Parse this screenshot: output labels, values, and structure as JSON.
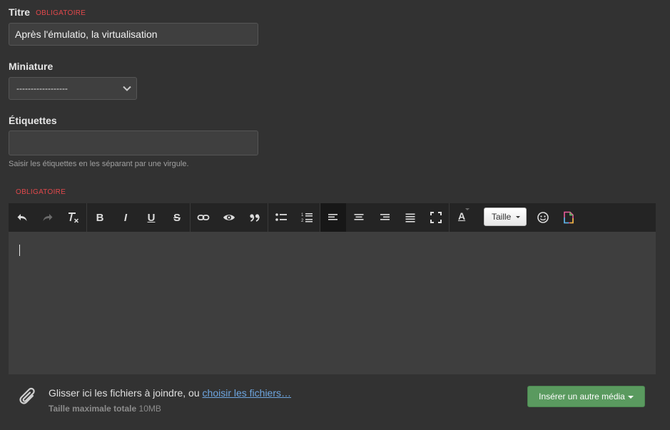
{
  "form": {
    "title": {
      "label": "Titre",
      "required": "OBLIGATOIRE",
      "value": "Après l'émulatio, la virtualisation"
    },
    "thumbnail": {
      "label": "Miniature",
      "selected": "------------------"
    },
    "tags": {
      "label": "Étiquettes",
      "value": "",
      "help": "Saisir les étiquettes en les séparant par une virgule."
    }
  },
  "editor": {
    "required": "OBLIGATOIRE",
    "toolbar": {
      "buttons": [
        {
          "name": "undo",
          "icon": "undo-icon"
        },
        {
          "name": "redo",
          "icon": "redo-icon"
        },
        {
          "name": "remove-format",
          "icon": "clear-format-icon"
        },
        {
          "name": "bold",
          "label": "B"
        },
        {
          "name": "italic",
          "label": "I"
        },
        {
          "name": "underline",
          "label": "U"
        },
        {
          "name": "strikethrough",
          "label": "S"
        },
        {
          "name": "link",
          "icon": "link-icon"
        },
        {
          "name": "preview",
          "icon": "eye-icon"
        },
        {
          "name": "quote",
          "icon": "quote-icon"
        },
        {
          "name": "bullet-list",
          "icon": "bullet-list-icon"
        },
        {
          "name": "numbered-list",
          "icon": "numbered-list-icon"
        },
        {
          "name": "align-left",
          "icon": "align-left-icon",
          "active": true
        },
        {
          "name": "align-center",
          "icon": "align-center-icon"
        },
        {
          "name": "align-right",
          "icon": "align-right-icon"
        },
        {
          "name": "justify",
          "icon": "justify-icon"
        },
        {
          "name": "fullscreen",
          "icon": "fullscreen-icon"
        },
        {
          "name": "text-color",
          "label": "A"
        },
        {
          "name": "emoji",
          "icon": "smiley-icon"
        },
        {
          "name": "paste-word",
          "icon": "document-icon"
        }
      ],
      "size_label": "Taille"
    },
    "content": ""
  },
  "attachments": {
    "drop_text": "Glisser ici les fichiers à joindre, ou ",
    "choose_link": "choisir les fichiers…",
    "max_size_label": "Taille maximale totale",
    "max_size_value": "10MB",
    "insert_button": "Insérer un autre média"
  },
  "colors": {
    "background": "#323232",
    "required": "#e2484b",
    "link": "#6ea6e0",
    "insert_button": "#5a9a5f",
    "toolbar": "#242424",
    "editor": "#3e3e3e"
  }
}
